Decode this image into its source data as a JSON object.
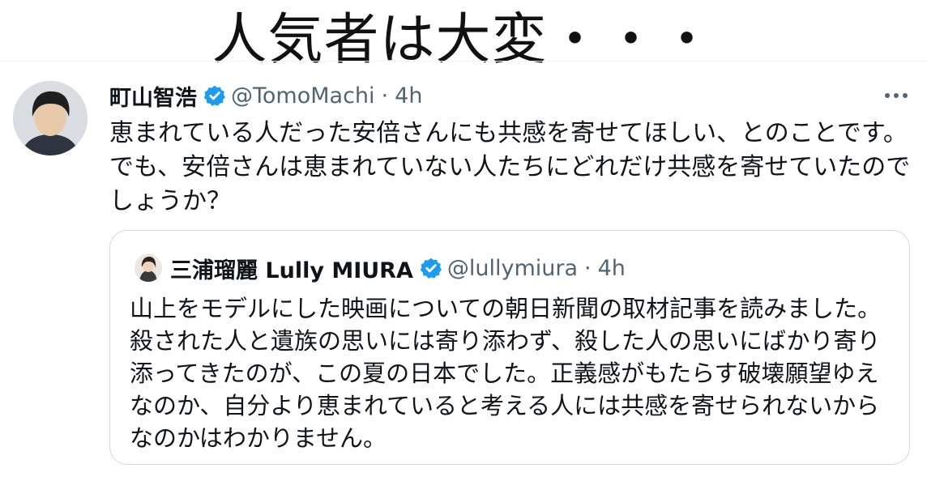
{
  "caption": "人気者は大変・・・",
  "tweet": {
    "name": "町山智浩",
    "handle": "@TomoMachi",
    "separator": "·",
    "time": "4h",
    "more_icon": "more-horizontal-icon",
    "text_lines": [
      "恵まれている人だった安倍さんにも共感を寄せてほしい、とのことです。",
      "でも、安倍さんは恵まれていない人たちにどれだけ共感を寄せていたので",
      "しょうか？"
    ]
  },
  "quoted": {
    "name": "三浦瑠麗 Lully MIURA",
    "handle": "@lullymiura",
    "separator": "·",
    "time": "4h",
    "text_lines": [
      "山上をモデルにした映画についての朝日新聞の取材記事を読みました。",
      "殺された人と遺族の思いには寄り添わず、殺した人の思いにばかり寄り",
      "添ってきたのが、この夏の日本でした。正義感がもたらす破壊願望ゆえ",
      "なのか、自分より恵まれていると考える人には共感を寄せられないから",
      "なのかはわかりません。"
    ]
  },
  "colors": {
    "verified": "#1d9bf0",
    "secondary_text": "#536471",
    "border": "#cfd9de"
  }
}
